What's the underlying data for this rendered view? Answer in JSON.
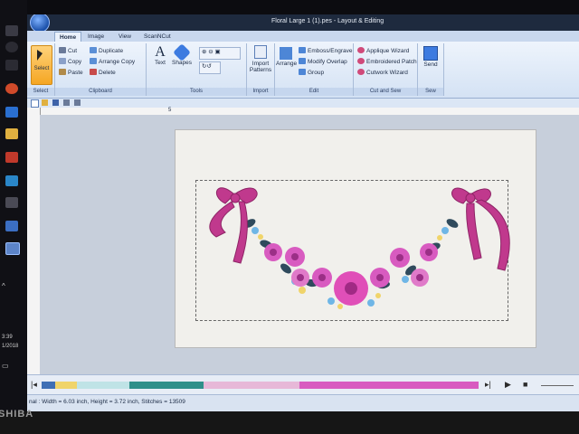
{
  "window": {
    "title": "Floral Large 1  (1).pes - Layout & Editing"
  },
  "tabs": [
    "Home",
    "Image",
    "View",
    "ScanNCut"
  ],
  "ribbon": {
    "select": {
      "label": "Select"
    },
    "clipboard": {
      "label": "Clipboard",
      "cut": "Cut",
      "copy": "Copy",
      "paste": "Paste",
      "duplicate": "Duplicate",
      "arrange_copy": "Arrange Copy",
      "delete": "Delete"
    },
    "tools": {
      "label": "Tools",
      "text": "Text",
      "shapes": "Shapes"
    },
    "import": {
      "label": "Import",
      "import_patterns": "Import Patterns"
    },
    "edit": {
      "label": "Edit",
      "arrange": "Arrange",
      "emboss": "Emboss/Engrave",
      "modify_overlap": "Modify Overlap",
      "group": "Group"
    },
    "cut_and_sew": {
      "label": "Cut and Sew",
      "applique": "Applique Wizard",
      "patch": "Embroidered Patch",
      "cutwork": "Cutwork Wizard"
    },
    "sew": {
      "label": "Sew",
      "send": "Send"
    }
  },
  "ruler": {
    "start_mark": "5"
  },
  "taskbar": {
    "time": "3:39",
    "date": "1/2018"
  },
  "status": {
    "text": "nal : Width = 6.03 inch, Height = 3.72 inch, Stitches = 13509"
  },
  "bezel": {
    "brand": "SHIBA"
  },
  "colors": {
    "ribbon_pink": "#c0398d",
    "flower_pink": "#d85bc0",
    "leaf": "#2f4a5c",
    "blue_accent": "#6fb6e6",
    "yellow_accent": "#f0d46a",
    "select_orange": "#f5a623"
  },
  "stitch_colors": [
    {
      "color": "#3f6fb5",
      "fraction": 0.03
    },
    {
      "color": "#f0d46a",
      "fraction": 0.05
    },
    {
      "color": "#bfe3e6",
      "fraction": 0.12
    },
    {
      "color": "#2f8f8a",
      "fraction": 0.17
    },
    {
      "color": "#e7b8d8",
      "fraction": 0.22
    },
    {
      "color": "#d85bc0",
      "fraction": 0.41
    }
  ]
}
